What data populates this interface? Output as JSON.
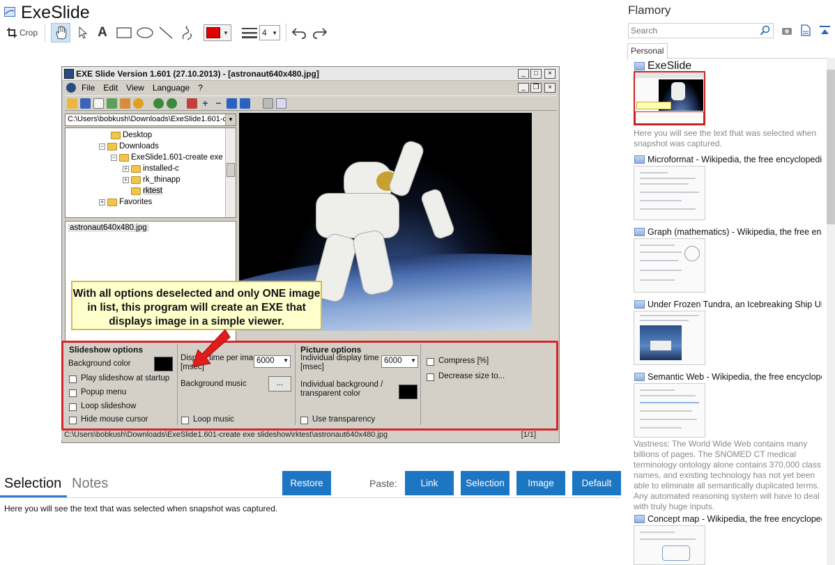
{
  "app": {
    "title": "ExeSlide"
  },
  "toolbar": {
    "crop_label": "Crop",
    "line_width": "4",
    "color": "#e00000"
  },
  "window": {
    "title": "EXE Slide Version 1.601 (27.10.2013) - [astronaut640x480.jpg]",
    "menu": [
      "File",
      "Edit",
      "View",
      "Language",
      "?"
    ],
    "path": "C:\\Users\\bobkush\\Downloads\\ExeSlide1.601-c",
    "tree": {
      "desktop": "Desktop",
      "downloads": "Downloads",
      "exeslide_folder": "ExeSlide1.601-create exe s",
      "installed": "installed-c",
      "rk_thinapp": "rk_thinapp",
      "rktest": "rktest",
      "favorites": "Favorites"
    },
    "file_item": "astronaut640x480.jpg",
    "callout": "With all options deselected and only ONE image in list, this program will create an EXE that displays image in a simple viewer.",
    "slideshow": {
      "heading": "Slideshow options",
      "bg_color": "Background color",
      "play": "Play slideshow at startup",
      "popup": "Popup menu",
      "loop": "Loop slideshow",
      "hide": "Hide mouse cursor"
    },
    "display": {
      "per_image": "Display time per image",
      "msec": "[msec]",
      "value": "6000",
      "bg_music": "Background music",
      "browse": "...",
      "loop_music": "Loop music"
    },
    "picture": {
      "heading": "Picture options",
      "individual": "Individual display time",
      "msec": "[msec]",
      "value": "6000",
      "ibg1": "Individual background /",
      "ibg2": "transparent color",
      "transparency": "Use transparency"
    },
    "compress": {
      "compress": "Compress [%]",
      "decrease": "Decrease size to..."
    },
    "status": {
      "path": "C:\\Users\\bobkush\\Downloads\\ExeSlide1.601-create exe slideshow\\rktest\\astronaut640x480.jpg",
      "count": "[1/1]"
    }
  },
  "bottom": {
    "tab_selection": "Selection",
    "tab_notes": "Notes",
    "restore": "Restore",
    "paste": "Paste:",
    "link": "Link",
    "selection": "Selection",
    "image": "Image",
    "default": "Default",
    "selected_text": "Here you will see the text that was selected when snapshot was captured."
  },
  "sidebar": {
    "app_name": "Flamory",
    "search_placeholder": "Search",
    "tab": "Personal",
    "items": [
      {
        "title": "ExeSlide",
        "desc": "Here you will see the text that was selected when snapshot was captured."
      },
      {
        "title": "Microformat - Wikipedia, the free encyclopedia"
      },
      {
        "title": "Graph (mathematics) - Wikipedia, the free ency"
      },
      {
        "title": "Under Frozen Tundra, an Icebreaking Ship Unco"
      },
      {
        "title": "Semantic Web - Wikipedia, the free encycloped",
        "desc": "Vastness: The World Wide Web contains many billions of pages. The SNOMED CT medical terminology ontology alone contains 370,000 class names, and existing technology has not yet been able to eliminate all semantically duplicated terms. Any automated reasoning system will have to deal with truly huge inputs."
      },
      {
        "title": "Concept map - Wikipedia, the free encyclopedi"
      }
    ]
  }
}
